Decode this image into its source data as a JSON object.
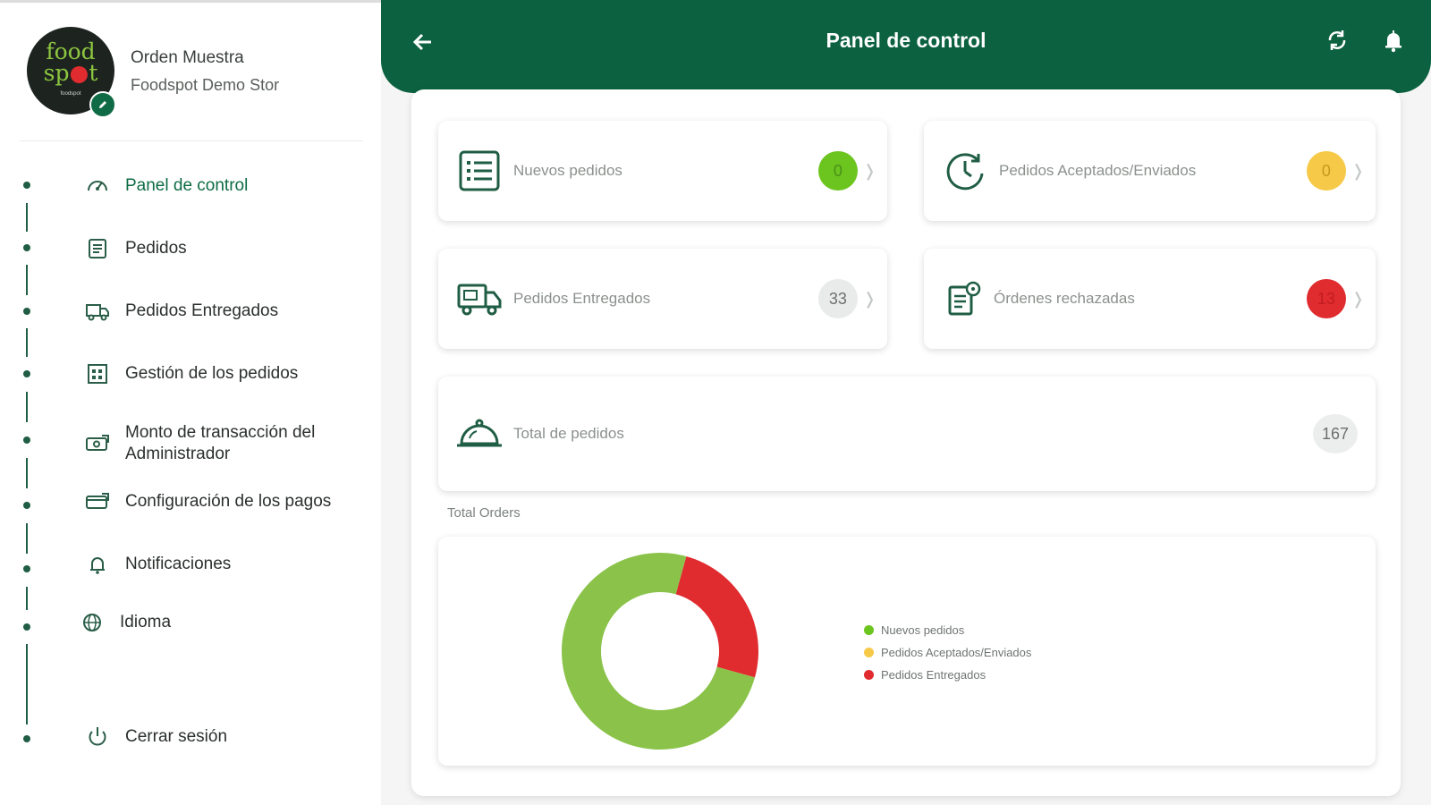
{
  "profile": {
    "logo_text": "food spot",
    "name": "Orden Muestra",
    "store": "Foodspot Demo Stor"
  },
  "sidebar": {
    "items": [
      {
        "label": "Panel de control",
        "icon": "speedometer-icon",
        "active": true
      },
      {
        "label": "Pedidos",
        "icon": "orders-list-icon"
      },
      {
        "label": "Pedidos Entregados",
        "icon": "delivery-truck-icon"
      },
      {
        "label": "Gestión de los pedidos",
        "icon": "order-management-icon"
      },
      {
        "label": "Monto de transacción del Administrador",
        "icon": "money-transfer-icon"
      },
      {
        "label": "Configuración de los pagos",
        "icon": "payment-settings-icon"
      },
      {
        "label": "Notificaciones",
        "icon": "bell-icon"
      },
      {
        "label": "Idioma",
        "icon": "globe-icon"
      },
      {
        "label": "Cerrar sesión",
        "icon": "power-icon"
      }
    ]
  },
  "header": {
    "title": "Panel de control"
  },
  "cards": {
    "new_orders": {
      "label": "Nuevos pedidos",
      "count": "0"
    },
    "accepted": {
      "label": "Pedidos Aceptados/Enviados",
      "count": "0"
    },
    "delivered": {
      "label": "Pedidos Entregados",
      "count": "33"
    },
    "rejected": {
      "label": "Órdenes rechazadas",
      "count": "13"
    },
    "total": {
      "label": "Total de pedidos",
      "count": "167"
    }
  },
  "chart_section_label": "Total Orders",
  "colors": {
    "brand_green": "#0b6140",
    "badge_green": "#6cc51f",
    "badge_yellow": "#f7c948",
    "badge_red": "#e02b2f",
    "chart_green": "#8bc34a",
    "chart_yellow": "#f7c948",
    "chart_red": "#e02b2f"
  },
  "chart_data": {
    "type": "pie",
    "categories": [
      "Nuevos pedidos",
      "Pedidos Aceptados/Enviados",
      "Pedidos Entregados"
    ],
    "values": [
      75,
      0,
      25
    ],
    "legend": "right"
  }
}
